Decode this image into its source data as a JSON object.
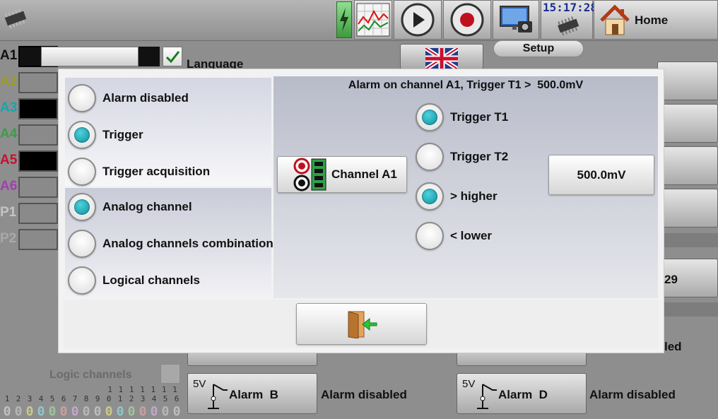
{
  "toolbar": {
    "time": "15:17:28",
    "home_label": "Home"
  },
  "channels": [
    {
      "name": "A1",
      "color": "#111111"
    },
    {
      "name": "A2",
      "color": "#9c9c2a"
    },
    {
      "name": "A3",
      "color": "#11a7b0"
    },
    {
      "name": "A4",
      "color": "#3f9a4a"
    },
    {
      "name": "A5",
      "color": "#c8102e"
    },
    {
      "name": "A6",
      "color": "#a33eb0"
    },
    {
      "name": "P1",
      "color": "#c0c0c0"
    },
    {
      "name": "P2",
      "color": "#a8a8a8"
    }
  ],
  "background": {
    "language_label": "Language",
    "setup_label": "Setup",
    "partial_value": "29",
    "partial_text": "led",
    "logic_channels_label": "Logic channels",
    "logic_digits_top": [
      "1",
      "1",
      "1",
      "1",
      "1",
      "1",
      "1"
    ],
    "logic_digits_mid": [
      "1",
      "2",
      "3",
      "4",
      "5",
      "6",
      "7",
      "8",
      "9",
      "0",
      "1",
      "2",
      "3",
      "4",
      "5",
      "6"
    ],
    "logic_values": [
      "0",
      "0",
      "0",
      "0",
      "0",
      "0",
      "0",
      "0",
      "0",
      "0",
      "0",
      "0",
      "0",
      "0",
      "0",
      "0"
    ],
    "alarm_b_label": "Alarm  B",
    "alarm_b_status": "Alarm disabled",
    "alarm_d_label": "Alarm  D",
    "alarm_d_status": "Alarm disabled",
    "alarm_voltage": "5V"
  },
  "dialog": {
    "title": "Alarm on channel A1, Trigger T1 >  500.0mV",
    "mode_options": [
      {
        "label": "Alarm disabled",
        "selected": false
      },
      {
        "label": "Trigger",
        "selected": true
      },
      {
        "label": "Trigger acquisition",
        "selected": false
      }
    ],
    "source_options": [
      {
        "label": "Analog channel",
        "selected": true
      },
      {
        "label": "Analog channels combination",
        "selected": false
      },
      {
        "label": "Logical channels",
        "selected": false
      }
    ],
    "channel_button": "Channel A1",
    "trigger_options": [
      {
        "label": "Trigger T1",
        "selected": true
      },
      {
        "label": "Trigger T2",
        "selected": false
      },
      {
        "label": "> higher",
        "selected": true
      },
      {
        "label": "< lower",
        "selected": false
      }
    ],
    "threshold_value": "500.0mV"
  }
}
